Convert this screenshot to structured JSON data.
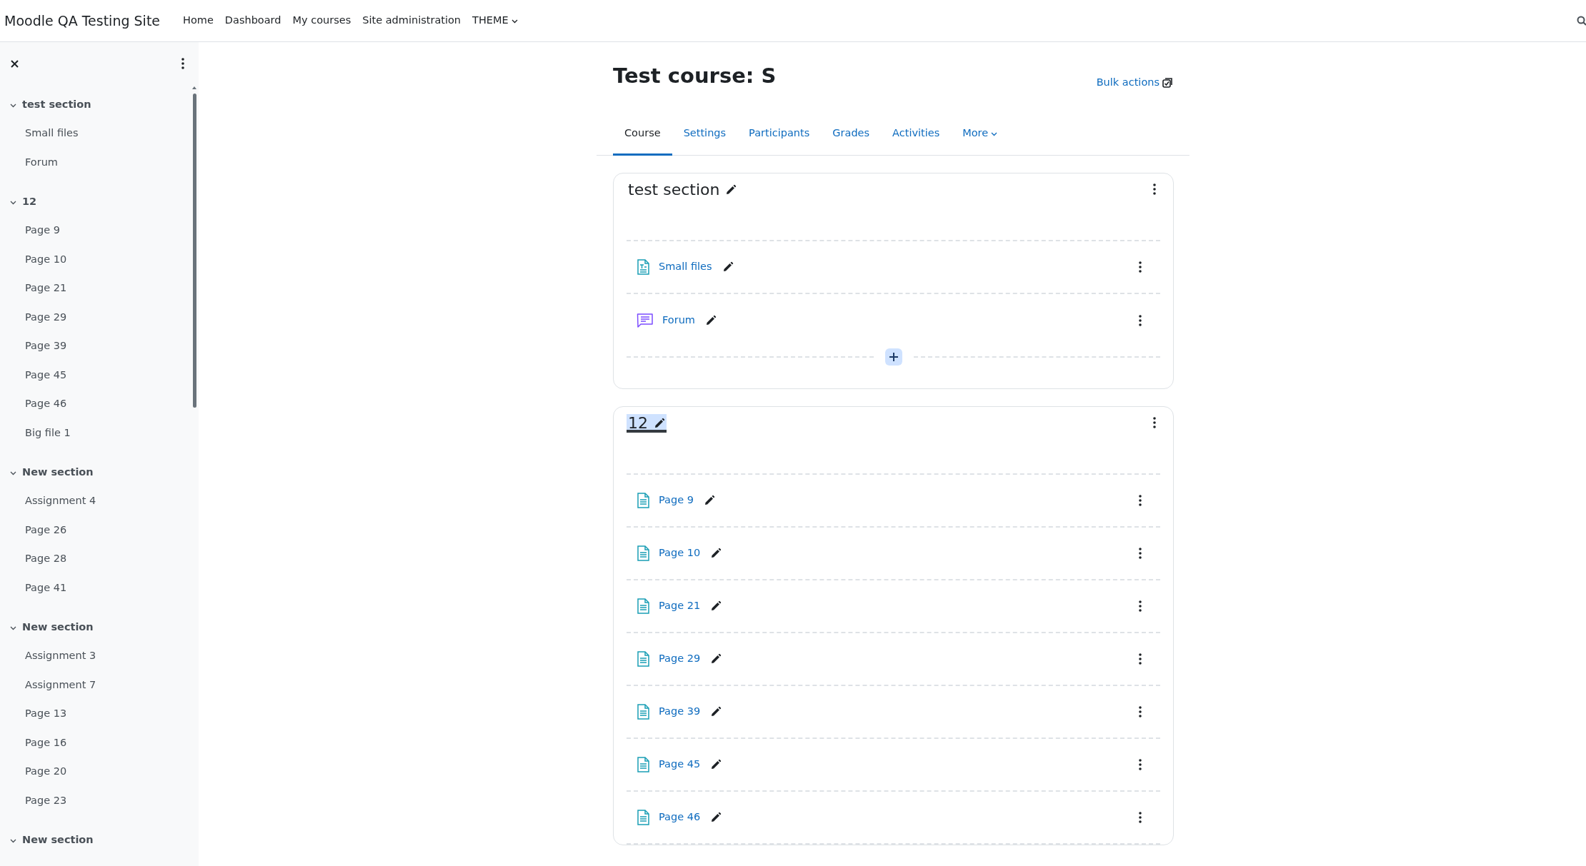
{
  "navbar": {
    "brand": "Moodle QA Testing Site",
    "links": [
      {
        "label": "Home",
        "dropdown": false
      },
      {
        "label": "Dashboard",
        "dropdown": false
      },
      {
        "label": "My courses",
        "dropdown": false
      },
      {
        "label": "Site administration",
        "dropdown": false
      },
      {
        "label": "THEME",
        "dropdown": true
      }
    ]
  },
  "course_index": {
    "sections": [
      {
        "title": "test section",
        "expanded": true,
        "items": [
          "Small files",
          "Forum"
        ]
      },
      {
        "title": "12",
        "expanded": true,
        "items": [
          "Page 9",
          "Page 10",
          "Page 21",
          "Page 29",
          "Page 39",
          "Page 45",
          "Page 46",
          "Big file 1"
        ]
      },
      {
        "title": "New section",
        "expanded": true,
        "items": [
          "Assignment 4",
          "Page 26",
          "Page 28",
          "Page 41"
        ]
      },
      {
        "title": "New section",
        "expanded": true,
        "items": [
          "Assignment 3",
          "Assignment 7",
          "Page 13",
          "Page 16",
          "Page 20",
          "Page 23"
        ]
      },
      {
        "title": "New section",
        "expanded": true
      }
    ]
  },
  "page_header": {
    "title": "Test course: S",
    "bulk_actions": "Bulk actions"
  },
  "tabs": [
    {
      "label": "Course",
      "selected": true,
      "dropdown": false
    },
    {
      "label": "Settings",
      "selected": false,
      "dropdown": false
    },
    {
      "label": "Participants",
      "selected": false,
      "dropdown": false
    },
    {
      "label": "Grades",
      "selected": false,
      "dropdown": false
    },
    {
      "label": "Activities",
      "selected": false,
      "dropdown": false
    },
    {
      "label": "More",
      "selected": false,
      "dropdown": true
    }
  ],
  "sections": [
    {
      "title": "test section",
      "focused": false,
      "add_activity": true,
      "activities": [
        {
          "kind": "file",
          "name": "Small files"
        },
        {
          "kind": "forum",
          "name": "Forum"
        }
      ]
    },
    {
      "title": "12",
      "focused": true,
      "add_activity": false,
      "activities": [
        {
          "kind": "page",
          "name": "Page 9"
        },
        {
          "kind": "page",
          "name": "Page 10"
        },
        {
          "kind": "page",
          "name": "Page 21"
        },
        {
          "kind": "page",
          "name": "Page 29"
        },
        {
          "kind": "page",
          "name": "Page 39"
        },
        {
          "kind": "page",
          "name": "Page 45"
        },
        {
          "kind": "page",
          "name": "Page 46"
        }
      ]
    }
  ]
}
